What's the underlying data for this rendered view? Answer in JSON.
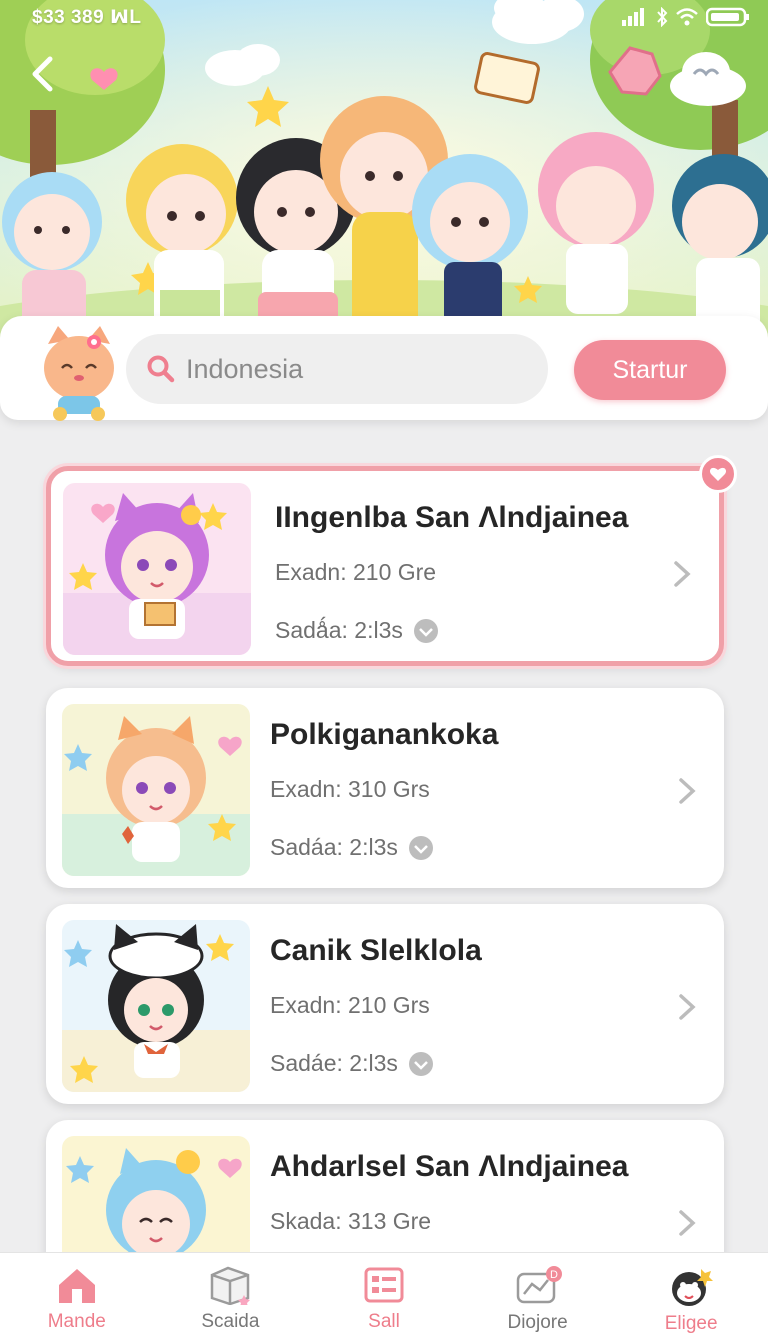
{
  "status_bar": {
    "time": "$33 389 ꟽL"
  },
  "search": {
    "placeholder": "Indonesia",
    "value": ""
  },
  "start_button": {
    "label": "Startur"
  },
  "cards": [
    {
      "title": "IIngenlba San Λlndjainea",
      "line1": "Exadn: 210 Gre",
      "line2": "Sadǻa: 2:l3s",
      "selected": true
    },
    {
      "title": "Polkiganankoka",
      "line1": "Exadn: 310 Grs",
      "line2": "Sadáa: 2:l3s",
      "selected": false
    },
    {
      "title": "Canik Slelklola",
      "line1": "Exadn: 210 Grs",
      "line2": "Sadáe: 2:l3s",
      "selected": false
    },
    {
      "title": "Ahdarlsel San Λlndjainea",
      "line1": "Skada: 313 Gre",
      "line2": "",
      "selected": false
    }
  ],
  "bottom_nav": [
    {
      "label": "Mande",
      "icon": "home-icon"
    },
    {
      "label": "Scaida",
      "icon": "box-icon"
    },
    {
      "label": "Sall",
      "icon": "list-icon"
    },
    {
      "label": "Diojore",
      "icon": "route-icon"
    },
    {
      "label": "Eligee",
      "icon": "mascot-icon"
    }
  ],
  "colors": {
    "accent": "#f18b98",
    "accent_text": "#ee7d8b",
    "background": "#eeeeef",
    "card": "#ffffff"
  }
}
